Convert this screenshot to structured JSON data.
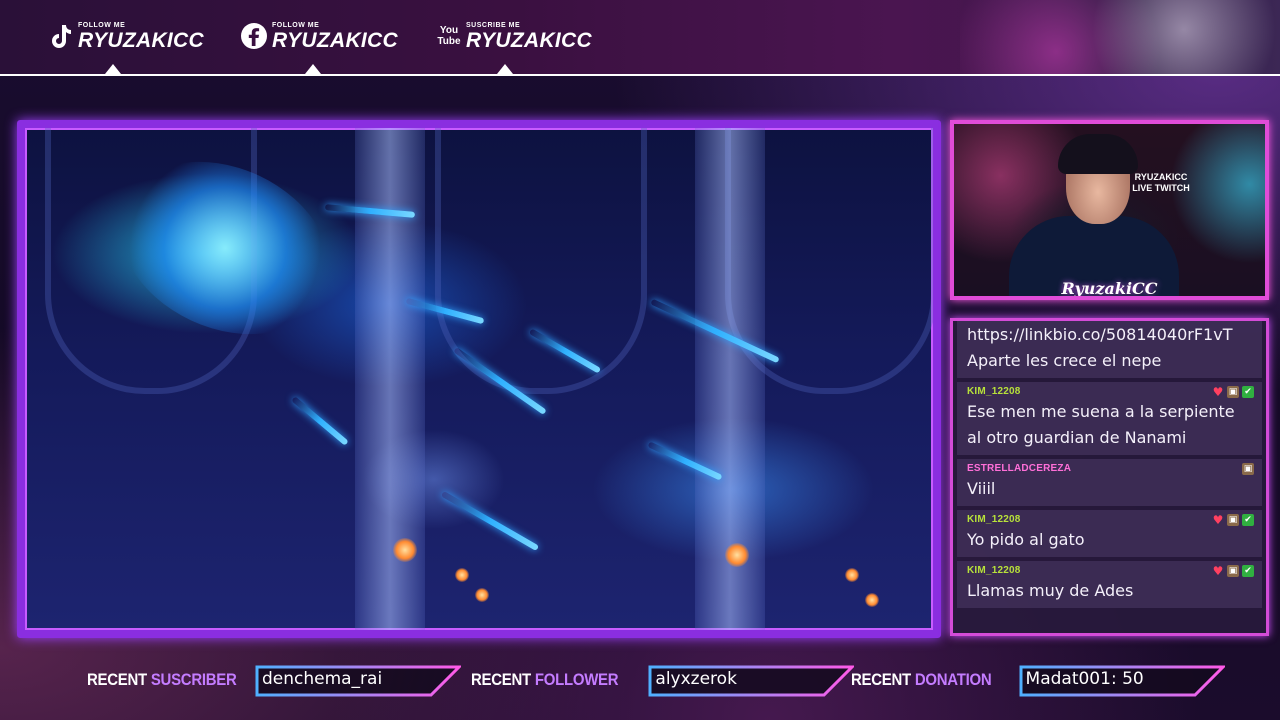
{
  "socials": [
    {
      "platform": "tiktok",
      "icon": "tiktok-icon",
      "small_label": "FOLLOW ME",
      "handle": "RYUZAKICC"
    },
    {
      "platform": "facebook",
      "icon": "facebook-icon",
      "small_label": "FOLLOW ME",
      "handle": "RYUZAKICC"
    },
    {
      "platform": "youtube",
      "icon": "youtube-icon",
      "icon_text": "You Tube",
      "small_label": "SUSCRIBE ME",
      "handle": "RYUZAKICC"
    }
  ],
  "webcam": {
    "sign_text": "RYUZAKICC LIVE TWITCH",
    "logo_text": "RyuzakiCC"
  },
  "chat": {
    "messages": [
      {
        "user": "",
        "user_color": "",
        "text_lines": [
          "https://linkbio.co/50814040rF1vT",
          "Aparte les crece el nepe"
        ],
        "badges": []
      },
      {
        "user": "KIM_12208",
        "user_color": "#b8e23a",
        "text_lines": [
          "Ese men me suena a la serpiente",
          "al otro guardian de Nanami"
        ],
        "badges": [
          "heart",
          "gift",
          "check"
        ]
      },
      {
        "user": "ESTRELLADCEREZA",
        "user_color": "#ff6fd8",
        "text_lines": [
          "Viiil"
        ],
        "badges": [
          "gift"
        ]
      },
      {
        "user": "KIM_12208",
        "user_color": "#b8e23a",
        "text_lines": [
          "Yo pido al gato"
        ],
        "badges": [
          "heart",
          "gift",
          "check"
        ]
      },
      {
        "user": "KIM_12208",
        "user_color": "#b8e23a",
        "text_lines": [
          "Llamas muy de Ades"
        ],
        "badges": [
          "heart",
          "gift",
          "check"
        ]
      }
    ]
  },
  "recent": {
    "subscriber": {
      "label_a": "RECENT",
      "label_b": "SUSCRIBER",
      "value": "denchema_rai"
    },
    "follower": {
      "label_a": "RECENT",
      "label_b": "FOLLOWER",
      "value": "alyxzerok"
    },
    "donation": {
      "label_a": "RECENT",
      "label_b": "DONATION",
      "value": "Madat001: 50"
    }
  },
  "colors": {
    "game_border": "#8a2ee0",
    "cam_border": "#e04cd8",
    "accent": "#c47cff",
    "box_border_a": "#ff5ae8",
    "box_border_b": "#4fb0ff"
  }
}
